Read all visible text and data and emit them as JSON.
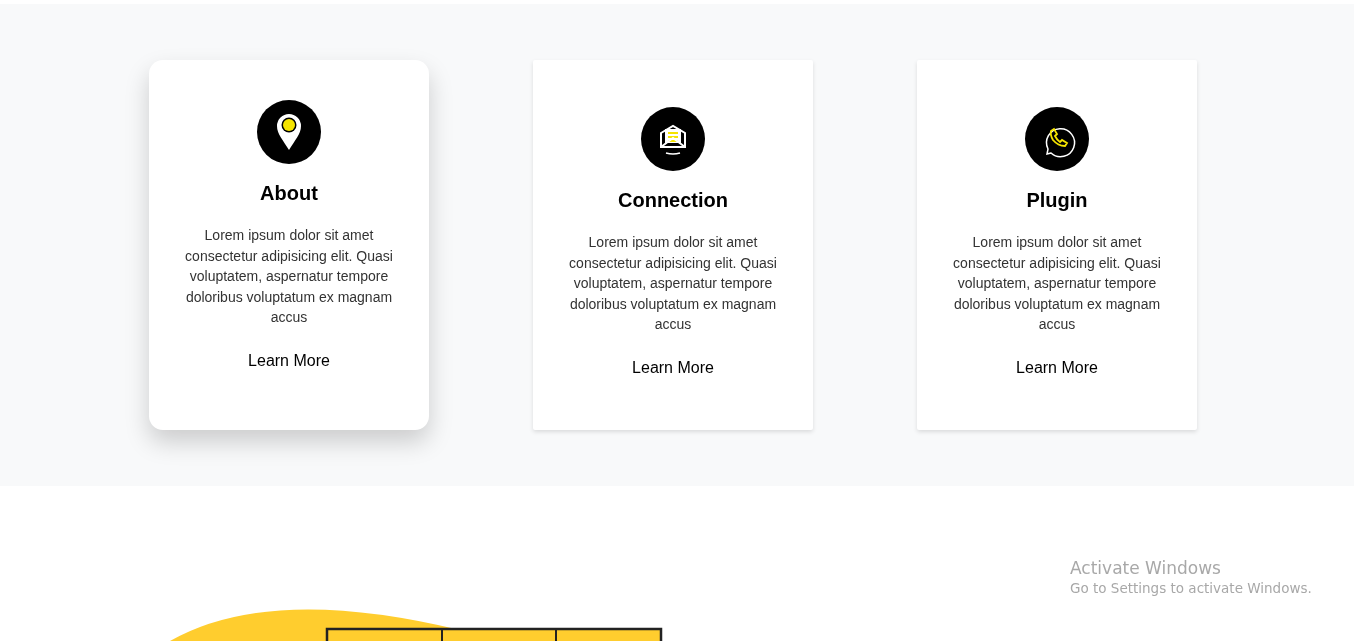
{
  "features": [
    {
      "kind": "pin",
      "title": "About",
      "text": "Lorem ipsum dolor sit amet consectetur adipisicing elit. Quasi voluptatem, aspernatur tempore doloribus voluptatum ex magnam accus",
      "link": "Learn More",
      "hovered": true
    },
    {
      "kind": "mail",
      "title": "Connection",
      "text": "Lorem ipsum dolor sit amet consectetur adipisicing elit. Quasi voluptatem, aspernatur tempore doloribus voluptatum ex magnam accus",
      "link": "Learn More",
      "hovered": false
    },
    {
      "kind": "phone",
      "title": "Plugin",
      "text": "Lorem ipsum dolor sit amet consectetur adipisicing elit. Quasi voluptatem, aspernatur tempore doloribus voluptatum ex magnam accus",
      "link": "Learn More",
      "hovered": false
    }
  ],
  "activation_notice": {
    "title": "Activate Windows",
    "text": "Go to Settings to activate Windows."
  }
}
